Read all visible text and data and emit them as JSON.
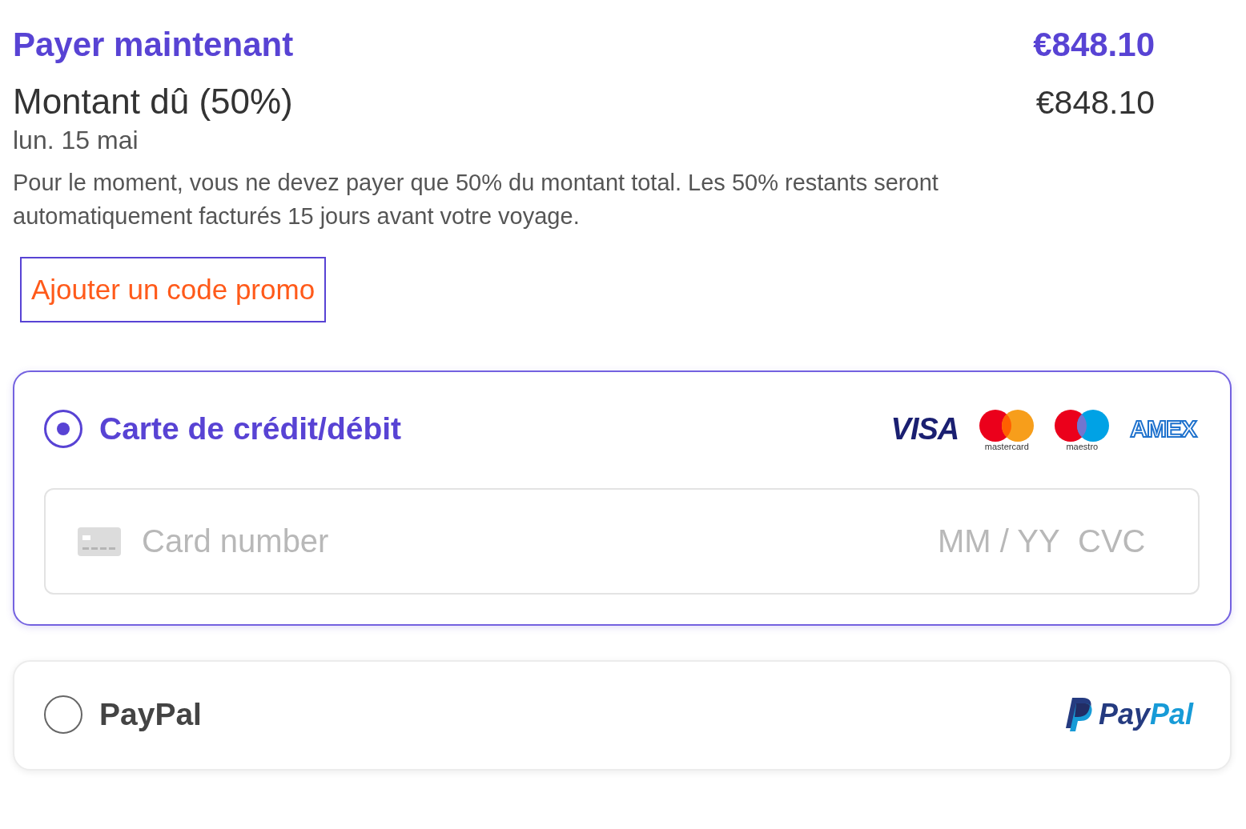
{
  "pay_now": {
    "title": "Payer maintenant",
    "amount": "€848.10"
  },
  "amount_due": {
    "label": "Montant dû (50%)",
    "amount": "€848.10",
    "date": "lun. 15 mai"
  },
  "notice": "Pour le moment, vous ne devez payer que 50% du montant total. Les 50% restants seront automatiquement facturés 15 jours avant votre voyage.",
  "promo_button": "Ajouter un code promo",
  "payment_methods": [
    {
      "kind": "card",
      "label": "Carte de crédit/débit",
      "selected": true,
      "brands": [
        {
          "kind": "visa",
          "label": "VISA"
        },
        {
          "kind": "mastercard",
          "label": "mastercard"
        },
        {
          "kind": "maestro",
          "label": "maestro"
        },
        {
          "kind": "amex",
          "label": "AMEX"
        }
      ],
      "card_field": {
        "placeholder": "Card number",
        "expiry_placeholder": "MM / YY",
        "cvc_placeholder": "CVC"
      }
    },
    {
      "kind": "paypal",
      "label": "PayPal",
      "selected": false,
      "logo": [
        "Pay",
        "Pal"
      ]
    }
  ]
}
